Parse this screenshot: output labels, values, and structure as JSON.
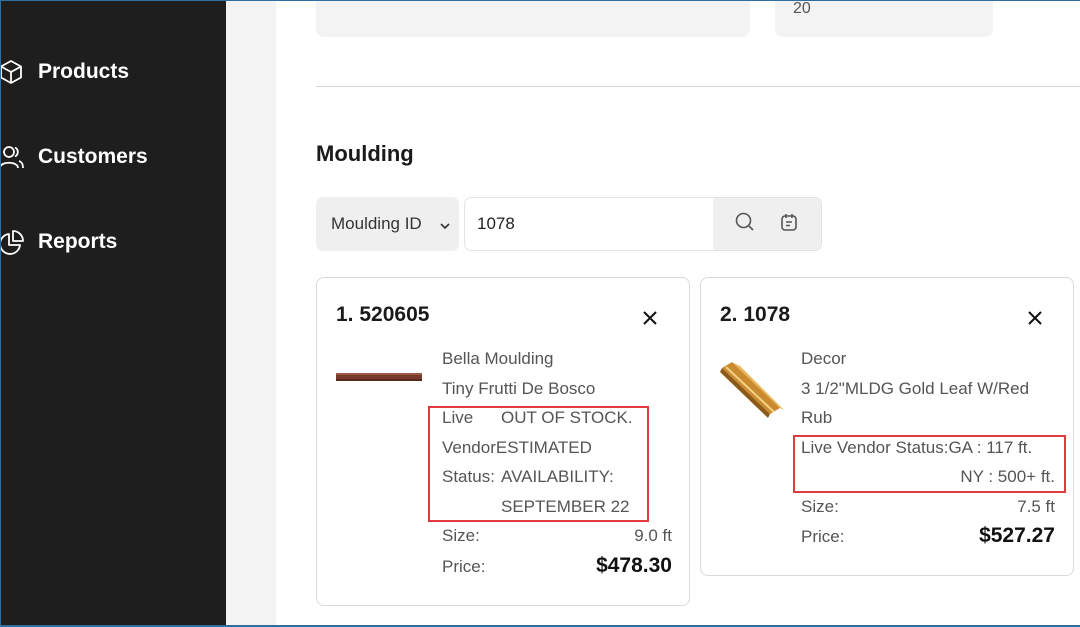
{
  "sidebar": {
    "items": [
      {
        "label": "Products",
        "icon": "cube-icon"
      },
      {
        "label": "Customers",
        "icon": "users-icon"
      },
      {
        "label": "Reports",
        "icon": "pie-chart-icon"
      }
    ]
  },
  "top_fields": {
    "right_value": "20"
  },
  "moulding": {
    "title": "Moulding",
    "filter_select": "Moulding ID",
    "search_value": "1078"
  },
  "cards": [
    {
      "title": "1. 520605",
      "brand": "Bella Moulding",
      "name": "Tiny Frutti De Bosco",
      "status_label_1": "Live",
      "status_label_2": "Vendor",
      "status_label_3": "Status:",
      "status_value_1": "OUT OF STOCK.",
      "status_value_2": "ESTIMATED",
      "status_value_3": "AVAILABILITY:",
      "status_value_4": "SEPTEMBER 22",
      "size_label": "Size:",
      "size_value": "9.0 ft",
      "price_label": "Price:",
      "price_value": "$478.30"
    },
    {
      "title": "2. 1078",
      "brand": "Decor",
      "name_line_1": "3 1/2\"MLDG Gold Leaf W/Red",
      "name_line_2": "Rub",
      "status_label": "Live Vendor Status:",
      "status_value_1": "GA : 117 ft.",
      "status_value_2": "NY : 500+ ft.",
      "size_label": "Size:",
      "size_value": "7.5 ft",
      "price_label": "Price:",
      "price_value": "$527.27"
    }
  ],
  "colors": {
    "sidebar_bg": "#1e1e1e",
    "highlight": "#e0393e",
    "panel_bg": "#f3f3f3"
  }
}
